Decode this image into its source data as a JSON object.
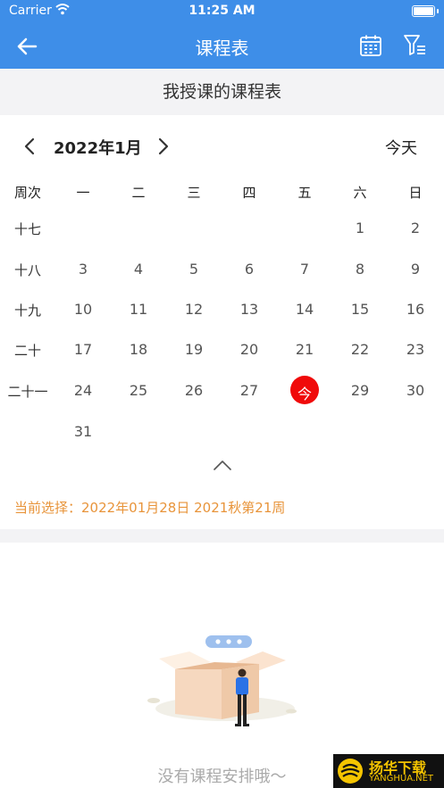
{
  "status_bar": {
    "carrier": "Carrier",
    "time": "11:25 AM"
  },
  "navbar": {
    "title": "课程表",
    "back_icon": "arrow-left-icon",
    "calendar_icon": "calendar-icon",
    "filter_icon": "filter-list-icon"
  },
  "subheader": {
    "title": "我授课的课程表"
  },
  "month_nav": {
    "label": "2022年1月",
    "today": "今天"
  },
  "calendar": {
    "week_col_header": "周次",
    "weekdays": [
      "一",
      "二",
      "三",
      "四",
      "五",
      "六",
      "日"
    ],
    "rows": [
      {
        "week": "十七",
        "days": [
          "",
          "",
          "",
          "",
          "",
          "1",
          "2"
        ]
      },
      {
        "week": "十八",
        "days": [
          "3",
          "4",
          "5",
          "6",
          "7",
          "8",
          "9"
        ]
      },
      {
        "week": "十九",
        "days": [
          "10",
          "11",
          "12",
          "13",
          "14",
          "15",
          "16"
        ]
      },
      {
        "week": "二十",
        "days": [
          "17",
          "18",
          "19",
          "20",
          "21",
          "22",
          "23"
        ]
      },
      {
        "week": "二十一",
        "days": [
          "24",
          "25",
          "26",
          "27",
          "今",
          "29",
          "30"
        ]
      },
      {
        "week": "",
        "days": [
          "31",
          "",
          "",
          "",
          "",
          "",
          ""
        ]
      }
    ],
    "today_row": 4,
    "today_col": 4,
    "today_color": "#f00a0a"
  },
  "selection": {
    "text": "当前选择：2022年01月28日 2021秋第21周"
  },
  "empty_state": {
    "message": "没有课程安排哦～"
  },
  "watermark": {
    "title": "扬华下载",
    "subtitle": "YANGHUA.NET"
  },
  "colors": {
    "primary": "#3e8ee8",
    "accent_orange": "#e8943a"
  }
}
